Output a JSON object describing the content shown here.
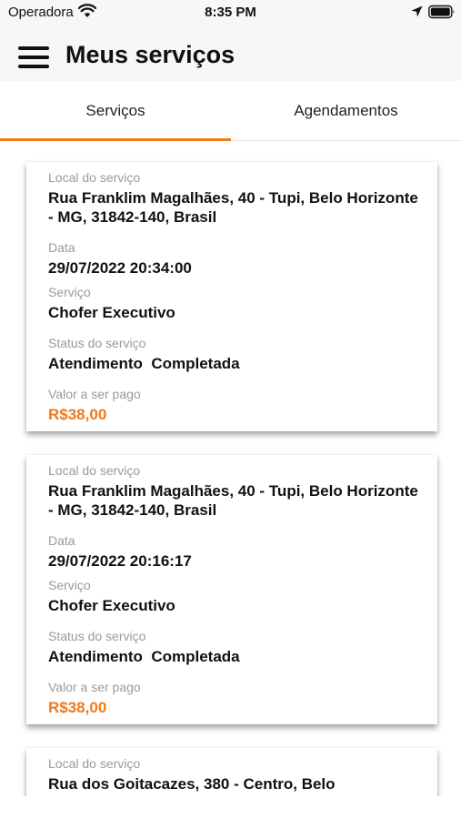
{
  "status_bar": {
    "carrier": "Operadora",
    "time": "8:35 PM",
    "icons": [
      "wifi-icon",
      "location-icon",
      "battery-icon"
    ]
  },
  "header": {
    "title": "Meus serviços",
    "menu_icon": "hamburger-menu-icon"
  },
  "tabs": [
    {
      "label": "Serviços",
      "active": true
    },
    {
      "label": "Agendamentos",
      "active": false
    }
  ],
  "accent_color": "#f07a1a",
  "labels": {
    "location": "Local do serviço",
    "date": "Data",
    "service": "Serviço",
    "status": "Status do serviço",
    "amount": "Valor a ser pago"
  },
  "services": [
    {
      "location": "Rua Franklim Magalhães, 40 - Tupi, Belo Horizonte - MG, 31842-140, Brasil",
      "date": "29/07/2022 20:34:00",
      "service": "Chofer Executivo",
      "status": "Atendimento  Completada",
      "amount": "R$38,00"
    },
    {
      "location": "Rua Franklim Magalhães, 40 - Tupi, Belo Horizonte - MG, 31842-140, Brasil",
      "date": "29/07/2022 20:16:17",
      "service": "Chofer Executivo",
      "status": "Atendimento  Completada",
      "amount": "R$38,00"
    },
    {
      "location": "Rua dos Goitacazes, 380 - Centro, Belo"
    }
  ]
}
